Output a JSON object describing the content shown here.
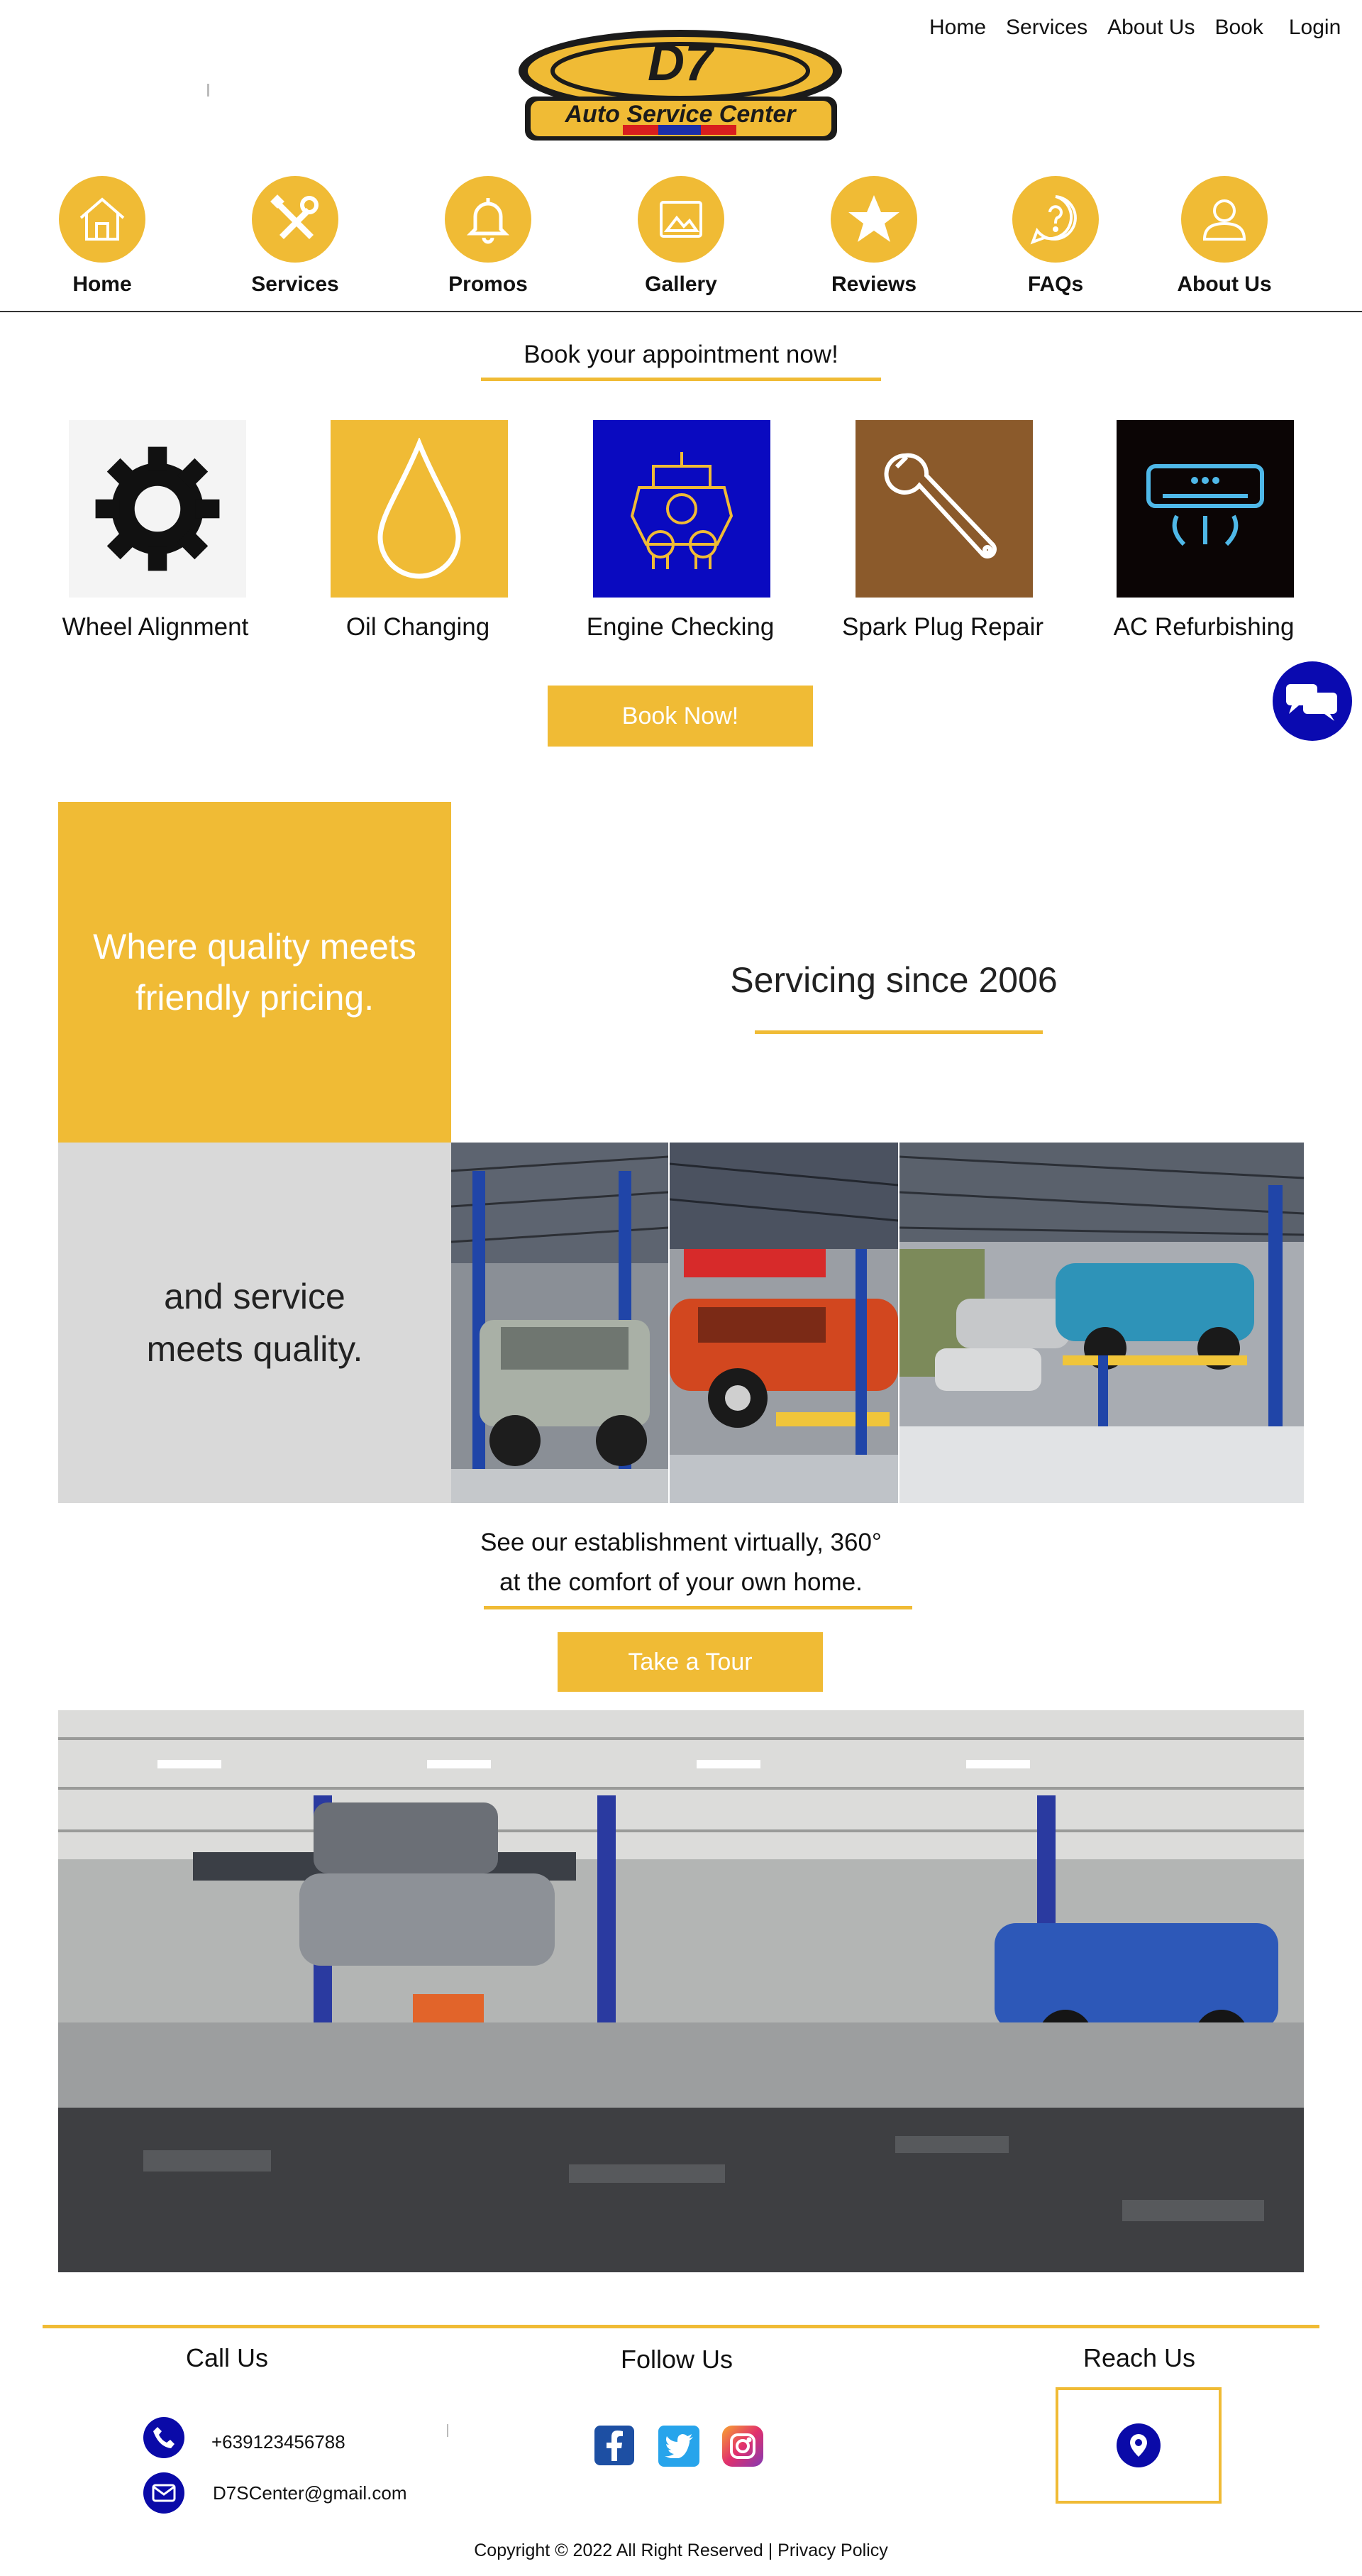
{
  "top_nav": [
    "Home",
    "Services",
    "About Us",
    "Book",
    "Login"
  ],
  "logo": {
    "main": "D7",
    "sub": "Auto Service Center"
  },
  "icon_nav": [
    {
      "label": "Home",
      "icon": "home-icon"
    },
    {
      "label": "Services",
      "icon": "tools-icon"
    },
    {
      "label": "Promos",
      "icon": "bell-icon"
    },
    {
      "label": "Gallery",
      "icon": "image-icon"
    },
    {
      "label": "Reviews",
      "icon": "star-icon"
    },
    {
      "label": "FAQs",
      "icon": "question-icon"
    },
    {
      "label": "About Us",
      "icon": "user-icon"
    }
  ],
  "appointment": {
    "heading": "Book your appointment now!",
    "book_button": "Book Now!"
  },
  "services": [
    {
      "label": "Wheel Alignment",
      "icon": "gear-icon"
    },
    {
      "label": "Oil Changing",
      "icon": "oil-drop-icon"
    },
    {
      "label": "Engine Checking",
      "icon": "engine-icon"
    },
    {
      "label": "Spark Plug Repair",
      "icon": "wrench-icon"
    },
    {
      "label": "AC Refurbishing",
      "icon": "air-conditioner-icon"
    }
  ],
  "about": {
    "quality_text": "Where quality meets friendly pricing.",
    "since_text": "Servicing since 2006",
    "service_text": "and service meets quality."
  },
  "tour": {
    "line1": "See our establishment virtually, 360°",
    "line2": "at the comfort of your own home.",
    "button": "Take a Tour"
  },
  "footer": {
    "call_title": "Call Us",
    "phone": "+639123456788",
    "email": "D7SCenter@gmail.com",
    "follow_title": "Follow Us",
    "reach_title": "Reach Us",
    "copyright": "Copyright © 2022 All Right Reserved | Privacy Policy"
  },
  "colors": {
    "accent": "#f0bb35",
    "navy": "#0a0aa8",
    "light_gray": "#d9d9d9"
  }
}
